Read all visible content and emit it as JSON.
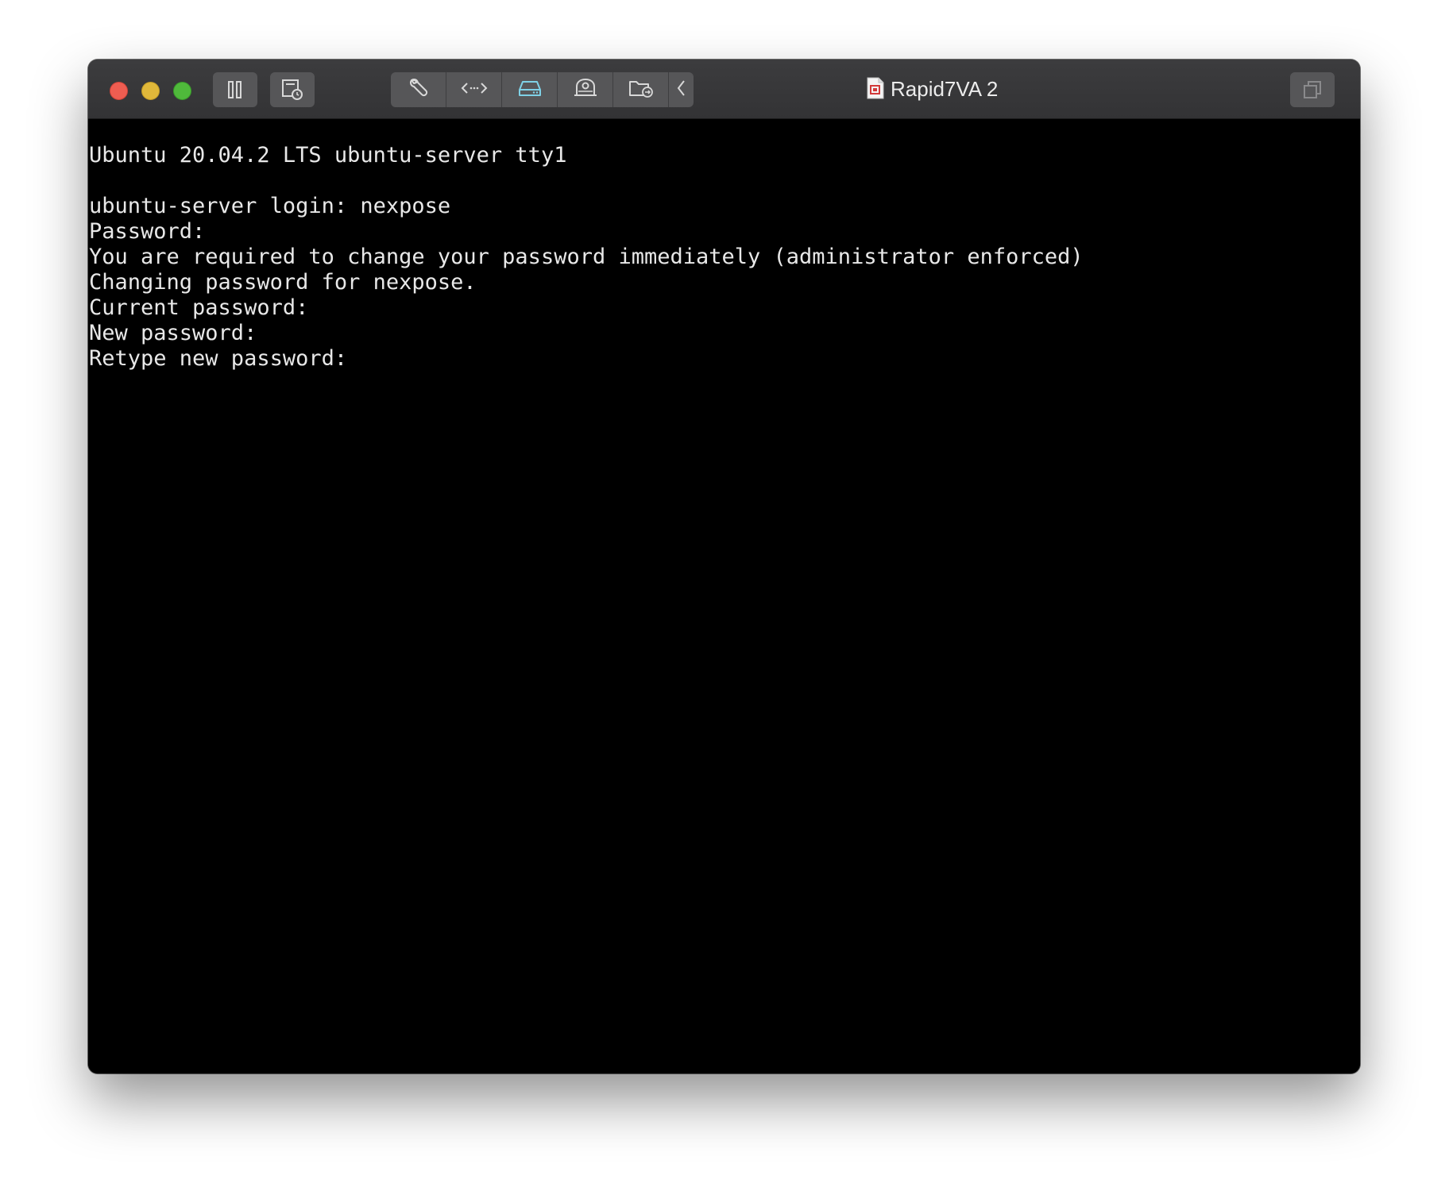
{
  "window": {
    "title": "Rapid7VA 2"
  },
  "toolbar": {
    "icons": [
      "pause-icon",
      "snapshot-icon",
      "wrench-icon",
      "code-icon",
      "hard-drive-icon",
      "camera-icon",
      "shared-folder-icon",
      "chevron-left-icon",
      "fullscreen-icon"
    ],
    "accent_color": "#7fd1e6"
  },
  "terminal": {
    "lines": [
      "Ubuntu 20.04.2 LTS ubuntu-server tty1",
      "",
      "ubuntu-server login: nexpose",
      "Password:",
      "You are required to change your password immediately (administrator enforced)",
      "Changing password for nexpose.",
      "Current password:",
      "New password:",
      "Retype new password:"
    ]
  }
}
